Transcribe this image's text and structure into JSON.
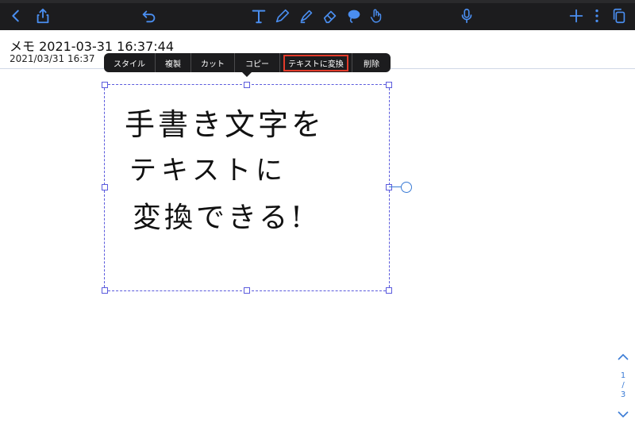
{
  "note": {
    "title": "メモ 2021-03-31 16:37:44",
    "date": "2021/03/31 16:37"
  },
  "context_menu": {
    "items": [
      "スタイル",
      "複製",
      "カット",
      "コピー",
      "テキストに変換",
      "削除"
    ],
    "highlighted_index": 4
  },
  "handwriting": {
    "lines": [
      "手書き文字を",
      "テキストに",
      "変換できる!"
    ]
  },
  "pager": {
    "current": "1",
    "total": "3"
  },
  "toolbar": {
    "left_icons": [
      "back-chevron-icon",
      "share-icon",
      "undo-icon"
    ],
    "tool_icons": [
      "text-tool-icon",
      "pen-tool-icon",
      "highlighter-icon",
      "eraser-icon",
      "lasso-icon",
      "touch-icon"
    ],
    "right_icons": [
      "microphone-icon",
      "add-icon",
      "more-icon",
      "pages-icon"
    ]
  },
  "colors": {
    "toolbar_bg": "#1c1c1e",
    "selection": "#5b5bdd",
    "accent": "#3a7bd5",
    "highlight": "#e23a2a",
    "tool_icon_color": "#4a8ef0"
  }
}
